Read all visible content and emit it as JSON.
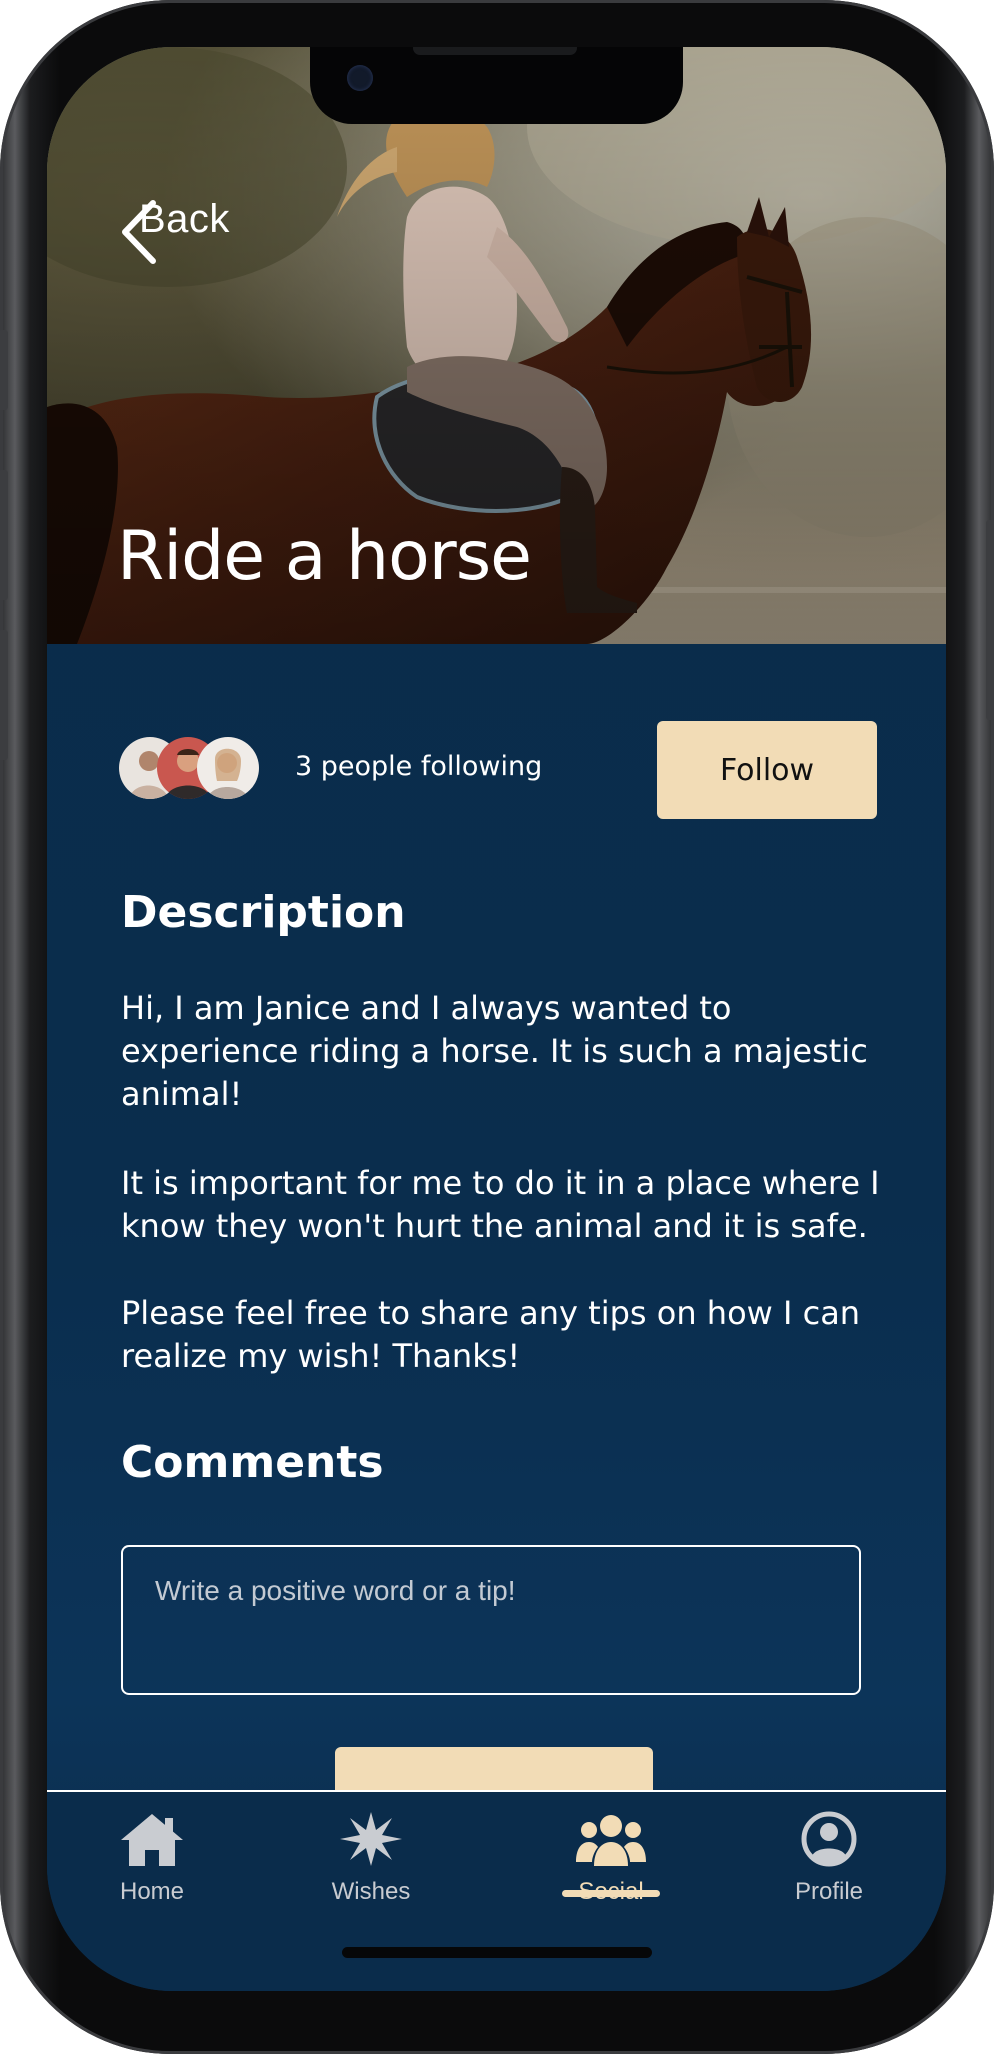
{
  "nav": {
    "back_label": "Back"
  },
  "hero": {
    "title": "Ride a horse"
  },
  "followers": {
    "text": "3 people following",
    "avatar_count": 3,
    "follow_label": "Follow"
  },
  "description": {
    "heading": "Description",
    "paragraphs": [
      "Hi, I am Janice and I always wanted to experience riding a horse. It is such a majestic animal!",
      "It is important for me to do it in a place where I know they won't hurt the animal and it is safe.",
      "Please feel free to share any tips on how I can realize my wish! Thanks!"
    ]
  },
  "comments": {
    "heading": "Comments",
    "placeholder": "Write a positive word or a tip!"
  },
  "tabbar": {
    "items": [
      {
        "label": "Home",
        "icon": "home-icon"
      },
      {
        "label": "Wishes",
        "icon": "star-burst-icon"
      },
      {
        "label": "Social",
        "icon": "group-icon",
        "active": true
      },
      {
        "label": "Profile",
        "icon": "user-circle-icon"
      }
    ]
  },
  "colors": {
    "background": "#0b2c49",
    "accent": "#f2dcb6",
    "text": "#ffffff",
    "tab_inactive": "#c9ccd1"
  }
}
